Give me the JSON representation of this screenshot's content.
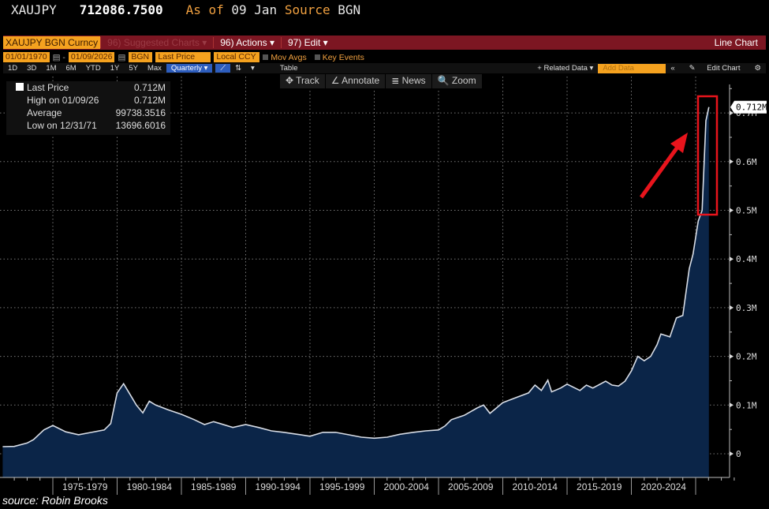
{
  "header": {
    "ticker": "XAUJPY",
    "price": "712086.7500",
    "as_of_label": "As of",
    "as_of_date": "09 Jan",
    "source_label": "Source",
    "source_value": "BGN"
  },
  "toolbar": {
    "security": "XAUJPY BGN Curncy",
    "suggested": "96) Suggested Charts ▾",
    "actions": "96) Actions ▾",
    "edit": "97) Edit ▾",
    "chart_type": "Line Chart"
  },
  "settings": {
    "start_date": "01/01/1970",
    "end_date": "01/09/2026",
    "source": "BGN",
    "field": "Last Price",
    "currency": "Local CCY",
    "mov_avgs": "Mov Avgs",
    "key_events": "Key Events"
  },
  "periods": [
    "1D",
    "3D",
    "1M",
    "6M",
    "YTD",
    "1Y",
    "5Y",
    "Max"
  ],
  "frequency": "Quarterly ▾",
  "table_label": "Table",
  "related_data": "+ Related Data ▾",
  "add_data_placeholder": "Add Data",
  "collapse": "«",
  "edit_chart": "Edit Chart",
  "tools": {
    "track": "✥ Track",
    "annotate": "∠ Annotate",
    "news": "≣ News",
    "zoom": "🔍 Zoom"
  },
  "legend": [
    {
      "label": "Last Price",
      "value": "0.712M"
    },
    {
      "label": "High on 01/09/26",
      "value": "0.712M"
    },
    {
      "label": "Average",
      "value": "99738.3516"
    },
    {
      "label": "Low on 12/31/71",
      "value": "13696.6016"
    }
  ],
  "source_note": "source: Robin Brooks",
  "colors": {
    "fill": "#0b2548",
    "line": "#d8dde6",
    "highlight": "#e8141c",
    "toolbar": "#7c1622",
    "field": "#f5a21f"
  },
  "chart_data": {
    "type": "area",
    "title": "",
    "xlabel": "",
    "ylabel": "",
    "x_tick_labels": [
      "1975-1979",
      "1980-1984",
      "1985-1989",
      "1990-1994",
      "1995-1999",
      "2000-2004",
      "2005-2009",
      "2010-2014",
      "2015-2019",
      "2020-2024"
    ],
    "y_tick_labels": [
      "0",
      "0.1M",
      "0.2M",
      "0.3M",
      "0.4M",
      "0.5M",
      "0.6M",
      "0.7M"
    ],
    "ylim": [
      -0.05,
      0.775
    ],
    "grid": true,
    "last_value_label": "0.712M",
    "unit": "M JPY",
    "series": [
      {
        "values": [
          [
            1971.1,
            0.0146
          ],
          [
            1972,
            0.015
          ],
          [
            1973,
            0.022
          ],
          [
            1973.5,
            0.029
          ],
          [
            1974.3,
            0.049
          ],
          [
            1975,
            0.058
          ],
          [
            1976,
            0.045
          ],
          [
            1977,
            0.039
          ],
          [
            1978,
            0.044
          ],
          [
            1979,
            0.049
          ],
          [
            1979.5,
            0.062
          ],
          [
            1980,
            0.125
          ],
          [
            1980.5,
            0.144
          ],
          [
            1981,
            0.122
          ],
          [
            1981.5,
            0.1
          ],
          [
            1982,
            0.084
          ],
          [
            1982.5,
            0.108
          ],
          [
            1983,
            0.1
          ],
          [
            1984,
            0.09
          ],
          [
            1985,
            0.081
          ],
          [
            1986,
            0.07
          ],
          [
            1986.8,
            0.06
          ],
          [
            1987.5,
            0.066
          ],
          [
            1988,
            0.062
          ],
          [
            1989,
            0.054
          ],
          [
            1990,
            0.06
          ],
          [
            1991,
            0.054
          ],
          [
            1992,
            0.047
          ],
          [
            1993,
            0.044
          ],
          [
            1994,
            0.04
          ],
          [
            1995,
            0.036
          ],
          [
            1996,
            0.044
          ],
          [
            1997,
            0.044
          ],
          [
            1998,
            0.039
          ],
          [
            1999,
            0.034
          ],
          [
            2000,
            0.032
          ],
          [
            2001,
            0.034
          ],
          [
            2002,
            0.04
          ],
          [
            2003,
            0.044
          ],
          [
            2004,
            0.047
          ],
          [
            2005,
            0.049
          ],
          [
            2005.5,
            0.057
          ],
          [
            2006,
            0.07
          ],
          [
            2007,
            0.079
          ],
          [
            2008,
            0.094
          ],
          [
            2008.5,
            0.1
          ],
          [
            2009,
            0.083
          ],
          [
            2009.5,
            0.094
          ],
          [
            2010,
            0.105
          ],
          [
            2011,
            0.115
          ],
          [
            2012,
            0.125
          ],
          [
            2012.5,
            0.141
          ],
          [
            2013,
            0.13
          ],
          [
            2013.5,
            0.151
          ],
          [
            2013.8,
            0.127
          ],
          [
            2014.5,
            0.135
          ],
          [
            2015,
            0.143
          ],
          [
            2016,
            0.13
          ],
          [
            2016.5,
            0.141
          ],
          [
            2017,
            0.135
          ],
          [
            2018,
            0.149
          ],
          [
            2018.5,
            0.141
          ],
          [
            2019,
            0.139
          ],
          [
            2019.5,
            0.149
          ],
          [
            2020,
            0.17
          ],
          [
            2020.5,
            0.2
          ],
          [
            2021,
            0.191
          ],
          [
            2021.5,
            0.2
          ],
          [
            2022,
            0.224
          ],
          [
            2022.3,
            0.246
          ],
          [
            2023,
            0.24
          ],
          [
            2023.5,
            0.279
          ],
          [
            2024,
            0.284
          ],
          [
            2024.5,
            0.38
          ],
          [
            2024.8,
            0.41
          ],
          [
            2025.2,
            0.478
          ],
          [
            2025.5,
            0.5
          ],
          [
            2025.8,
            0.684
          ],
          [
            2026.03,
            0.712
          ]
        ]
      }
    ]
  }
}
